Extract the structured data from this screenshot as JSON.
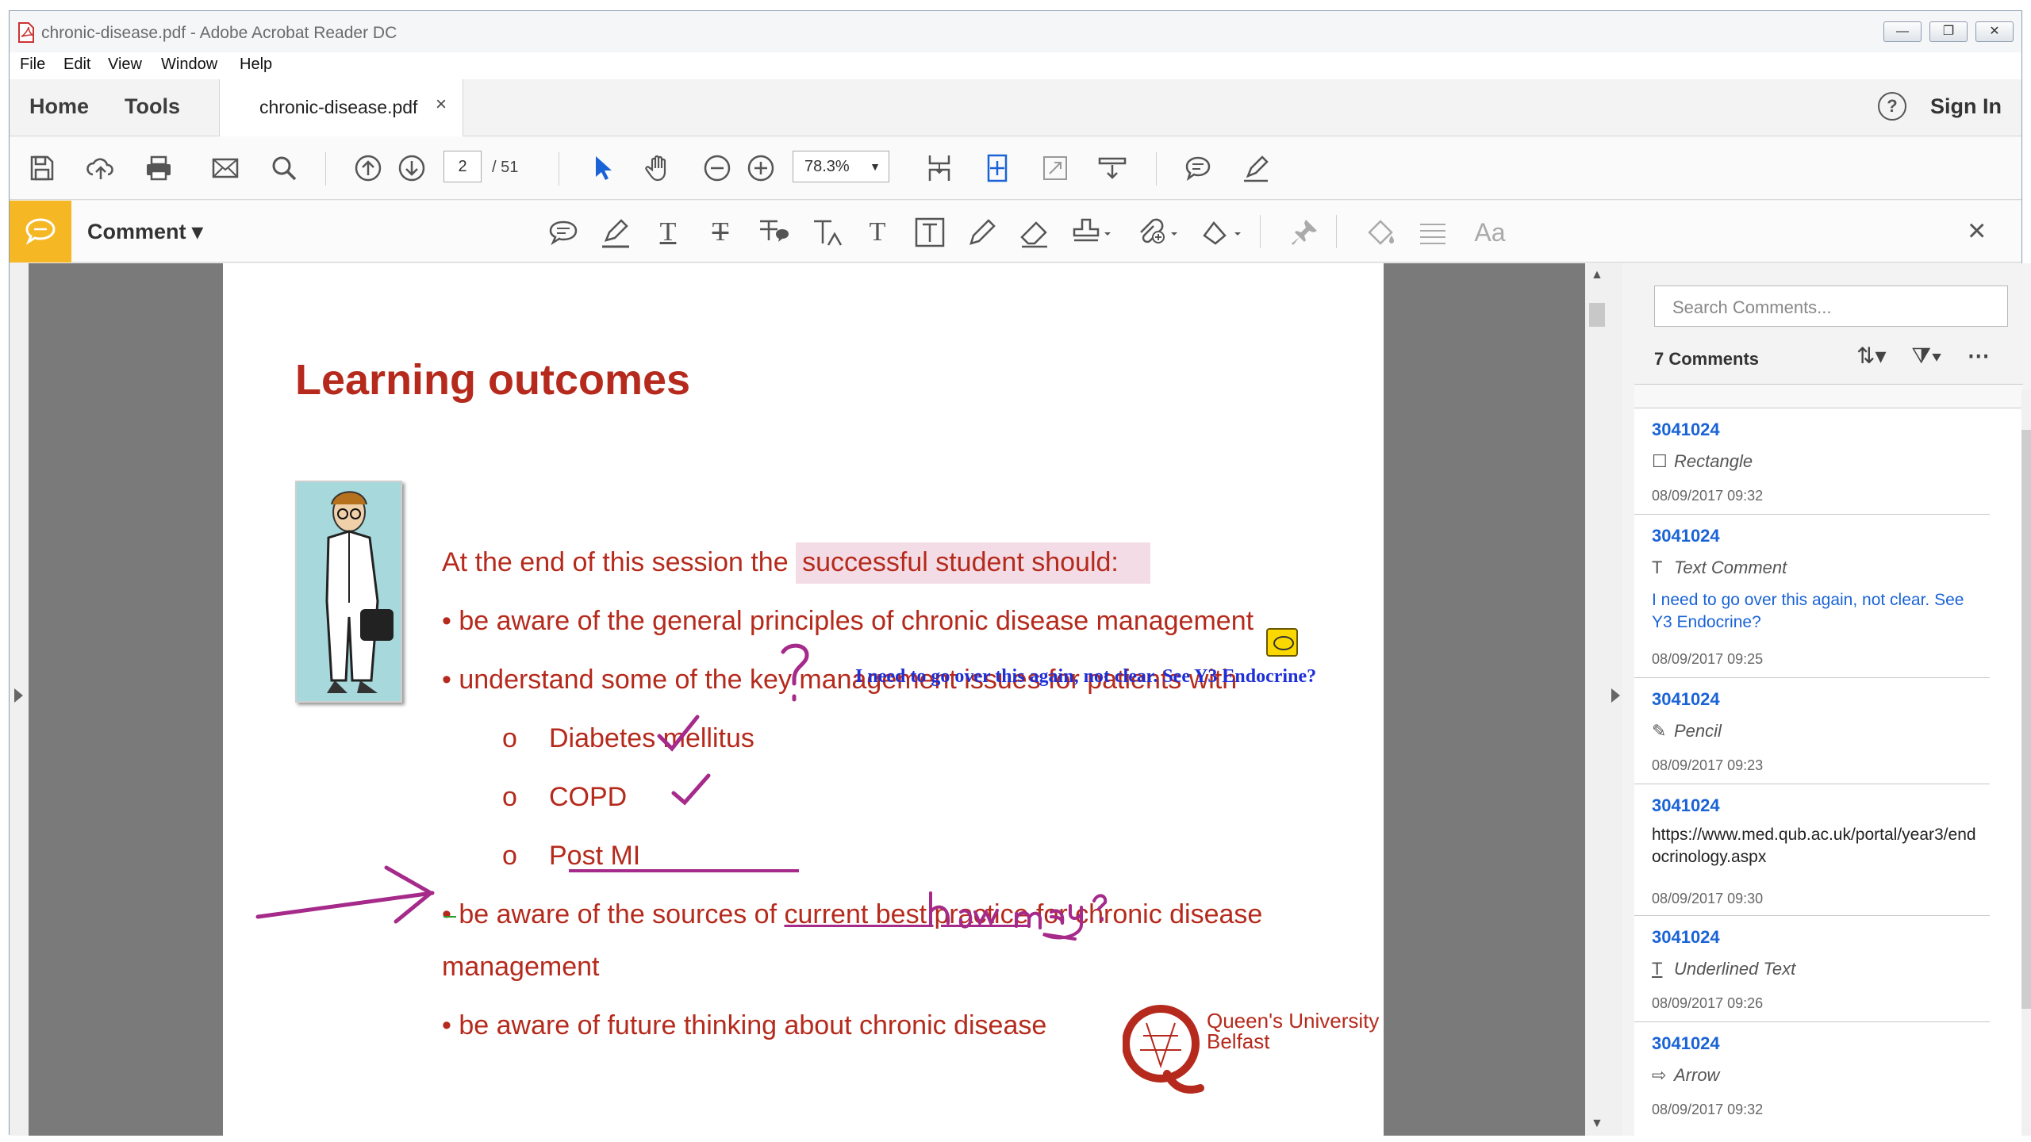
{
  "window": {
    "title": "chronic-disease.pdf - Adobe Acrobat Reader DC"
  },
  "menu": [
    "File",
    "Edit",
    "View",
    "Window",
    "Help"
  ],
  "tabs": {
    "home": "Home",
    "tools": "Tools",
    "doc_tab": "chronic-disease.pdf",
    "close": "×",
    "sign_in": "Sign In",
    "help": "?"
  },
  "toolbar": {
    "page_current": "2",
    "page_total": "/ 51",
    "zoom": "78.3%",
    "zoom_caret": "▼"
  },
  "commentbar": {
    "label": "Comment ▾",
    "close": "×",
    "text_tool": "T",
    "font_tool": "Aa"
  },
  "slide": {
    "title": "Learning outcomes",
    "intro_pre": "At the end of this session the ",
    "intro_hl": "successful student should:",
    "b1": "• be aware of the general principles of chronic disease management",
    "b2": "• understand some of the key management issues for patients with",
    "s1_marker": "o",
    "s1": "Diabetes mellitus",
    "s2_marker": "o",
    "s2": "COPD",
    "s3_marker": "o",
    "s3": "Post MI",
    "b3_pre": "• be aware of the sources of ",
    "b3_ul": "current best practice",
    "b3_post": " for chronic disease",
    "b3_cont": "management",
    "b4": "• be aware of  future thinking about chronic disease",
    "annotation": "I need to go over this again, not clear. See Y3 Endocrine?",
    "qub_line1": "Queen's University",
    "qub_line2": "Belfast"
  },
  "panel": {
    "search_placeholder": "Search Comments...",
    "count": "7 Comments",
    "comments": [
      {
        "user": "3041024",
        "type": "Rectangle",
        "icon": "☐",
        "date": "08/09/2017  09:32"
      },
      {
        "user": "3041024",
        "type": "Text Comment",
        "icon": "T",
        "body": "I need to go over this again, not clear. See Y3 Endocrine?",
        "date": "08/09/2017  09:25"
      },
      {
        "user": "3041024",
        "type": "Pencil",
        "icon": "✎",
        "date": "08/09/2017  09:23"
      },
      {
        "user": "3041024",
        "body": "https://www.med.qub.ac.uk/portal/year3/endocrinology.aspx",
        "date": "08/09/2017  09:30"
      },
      {
        "user": "3041024",
        "type": "Underlined Text",
        "icon": "T",
        "date": "08/09/2017  09:26"
      },
      {
        "user": "3041024",
        "type": "Arrow",
        "icon": "⇨",
        "date": "08/09/2017  09:32"
      }
    ]
  },
  "colors": {
    "accent": "#f5b724",
    "slide_red": "#b52a1c",
    "ink_purple": "#a52a8a",
    "link_blue": "#1a63d6",
    "annotation_blue": "#1d2fd8"
  }
}
